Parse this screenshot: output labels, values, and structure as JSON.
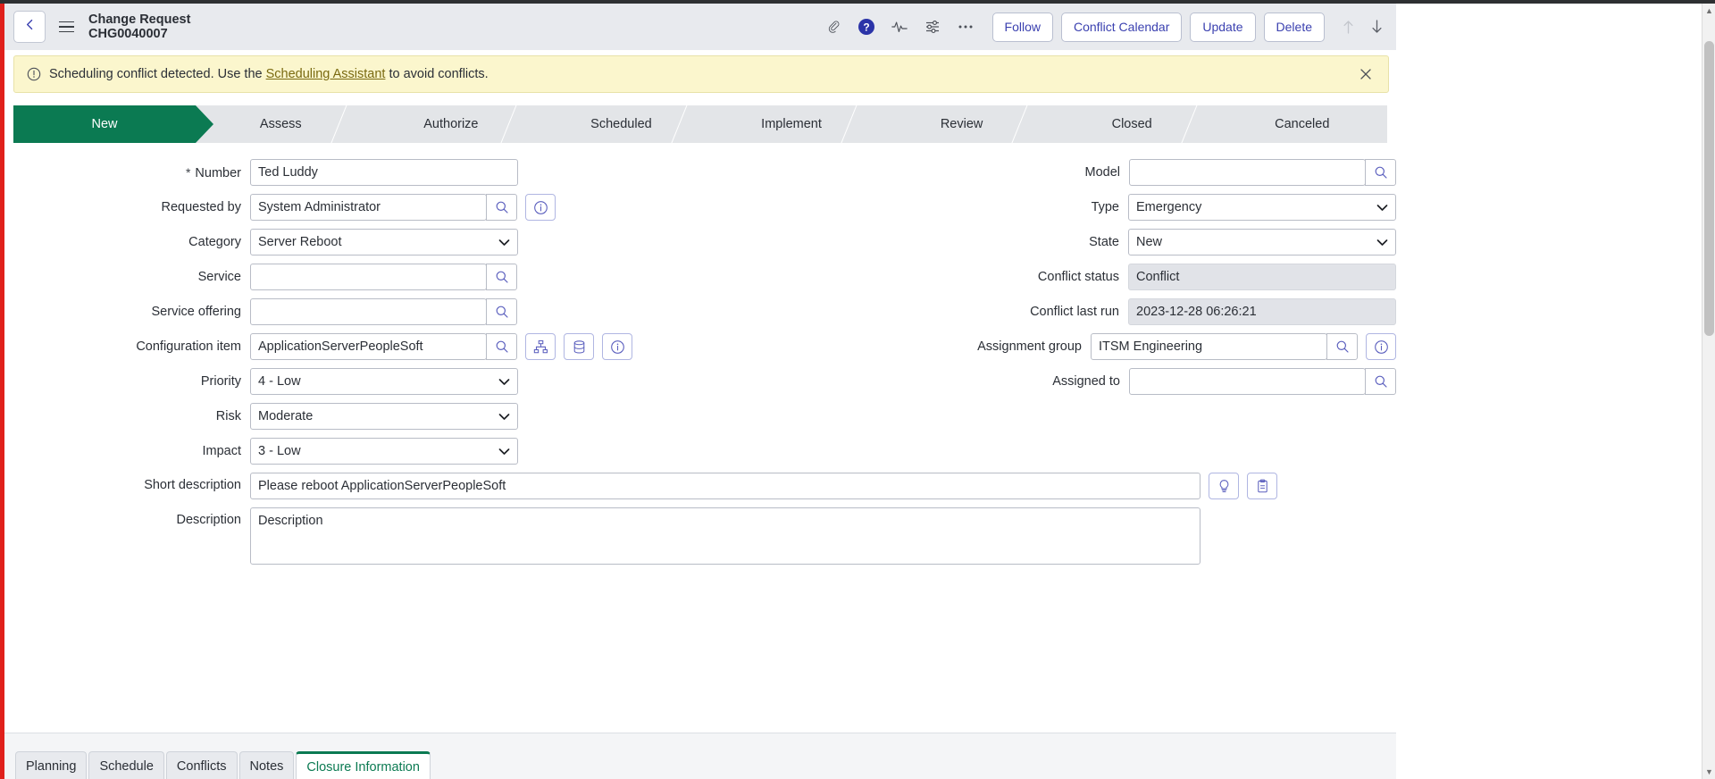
{
  "header": {
    "back_icon": "chevron-left-icon",
    "menu_icon": "hamburger-menu-icon",
    "title_line1": "Change Request",
    "title_line2": "CHG0040007",
    "icons": [
      {
        "name": "attachment-icon",
        "label": "Attachments"
      },
      {
        "name": "help-icon",
        "label": "Help"
      },
      {
        "name": "activity-icon",
        "label": "Activity"
      },
      {
        "name": "personalize-icon",
        "label": "Personalize Form"
      },
      {
        "name": "more-options-icon",
        "label": "More options"
      }
    ],
    "buttons": [
      {
        "name": "follow-button",
        "label": "Follow"
      },
      {
        "name": "conflict-calendar-button",
        "label": "Conflict Calendar"
      },
      {
        "name": "update-button",
        "label": "Update"
      },
      {
        "name": "delete-button",
        "label": "Delete"
      }
    ],
    "nav_up_icon": "arrow-up-icon",
    "nav_down_icon": "arrow-down-icon"
  },
  "banner": {
    "icon": "warning-circle-icon",
    "text_before": "Scheduling conflict detected. Use the",
    "link_text": "Scheduling Assistant",
    "text_after": "to avoid conflicts.",
    "close_icon": "close-icon",
    "background": "#fbf6cd"
  },
  "process_flow": {
    "active_color": "#0b7a52",
    "stages": [
      {
        "label": "New",
        "active": true
      },
      {
        "label": "Assess",
        "active": false
      },
      {
        "label": "Authorize",
        "active": false
      },
      {
        "label": "Scheduled",
        "active": false
      },
      {
        "label": "Implement",
        "active": false
      },
      {
        "label": "Review",
        "active": false
      },
      {
        "label": "Closed",
        "active": false
      },
      {
        "label": "Canceled",
        "active": false
      }
    ]
  },
  "form": {
    "left": {
      "number": {
        "label": "Number",
        "value": "Ted Luddy",
        "required": true,
        "star": "*"
      },
      "requested_by": {
        "label": "Requested by",
        "value": "System Administrator",
        "search_icon": "magnifier-icon",
        "info_icon": "info-circle-icon"
      },
      "category": {
        "label": "Category",
        "value": "Server Reboot"
      },
      "service": {
        "label": "Service",
        "value": "",
        "search_icon": "magnifier-icon"
      },
      "service_offering": {
        "label": "Service offering",
        "value": "",
        "search_icon": "magnifier-icon"
      },
      "configuration_item": {
        "label": "Configuration item",
        "value": "ApplicationServerPeopleSoft",
        "search_icon": "magnifier-icon",
        "map_icon": "hierarchy-icon",
        "db_icon": "database-icon",
        "info_icon": "info-circle-icon"
      },
      "priority": {
        "label": "Priority",
        "value": "4 - Low"
      },
      "risk": {
        "label": "Risk",
        "value": "Moderate"
      },
      "impact": {
        "label": "Impact",
        "value": "3 - Low"
      }
    },
    "right": {
      "model": {
        "label": "Model",
        "value": "",
        "search_icon": "magnifier-icon"
      },
      "type": {
        "label": "Type",
        "value": "Emergency"
      },
      "state": {
        "label": "State",
        "value": "New"
      },
      "conflict_status": {
        "label": "Conflict status",
        "value": "Conflict",
        "readonly": true
      },
      "conflict_last_run": {
        "label": "Conflict last run",
        "value": "2023-12-28 06:26:21",
        "readonly": true
      },
      "assignment_group": {
        "label": "Assignment group",
        "value": "ITSM Engineering",
        "search_icon": "magnifier-icon",
        "info_icon": "info-circle-icon"
      },
      "assigned_to": {
        "label": "Assigned to",
        "value": "",
        "search_icon": "magnifier-icon"
      }
    },
    "short_description": {
      "label": "Short description",
      "value": "Please reboot ApplicationServerPeopleSoft",
      "suggest_icon": "lightbulb-icon",
      "template_icon": "clipboard-icon"
    },
    "description": {
      "label": "Description",
      "value": "Description"
    }
  },
  "bottom_tabs": {
    "active_color": "#0b7a52",
    "items": [
      {
        "label": "Planning",
        "active": false
      },
      {
        "label": "Schedule",
        "active": false
      },
      {
        "label": "Conflicts",
        "active": false
      },
      {
        "label": "Notes",
        "active": false
      },
      {
        "label": "Closure Information",
        "active": true
      }
    ]
  }
}
